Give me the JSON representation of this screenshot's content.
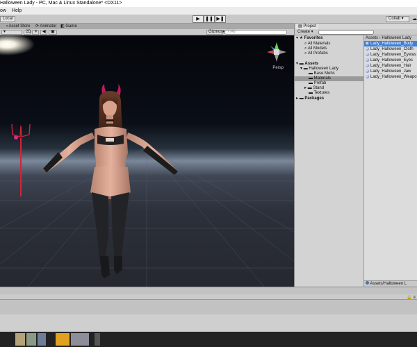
{
  "window": {
    "title": "Halloween Lady - PC, Mac & Linux Standalone* <DX11>"
  },
  "menu": {
    "items": [
      "ow",
      "Help"
    ]
  },
  "toolbar": {
    "local_label": "Local",
    "play_icon": "play-icon",
    "pause_icon": "pause-icon",
    "step_icon": "step-icon",
    "collab_label": "Collab"
  },
  "tabs": [
    {
      "label": "Asset Store"
    },
    {
      "label": "Animator"
    },
    {
      "label": "Game"
    }
  ],
  "scene_toolbar": {
    "mode_2d": "2D",
    "gizmos_label": "Gizmos",
    "search_placeholder": "ⓒAll",
    "persp_label": "Persp"
  },
  "project": {
    "tab_label": "Project",
    "create_label": "Create",
    "favorites": {
      "label": "Favorites",
      "items": [
        "All Materials",
        "All Models",
        "All Prefabs"
      ]
    },
    "assets": {
      "label": "Assets",
      "root_folder": "Halloween Lady",
      "subfolders": [
        "Base Mehs",
        "Materials",
        "Prefab",
        "Stand",
        "Textures"
      ]
    },
    "packages_label": "Packages",
    "breadcrumb": "Assets › Halloween Lady",
    "files": [
      "Lady_Halloween_Body",
      "Lady_Halloween_Cloth",
      "Lady_Halloween_Eyelas",
      "Lady_Halloween_Eyes",
      "Lady_Halloween_Hair",
      "Lady_Halloween_Jaw",
      "Lady_Halloween_Weapo"
    ],
    "footer_path": "Assets/Halloween L"
  },
  "colors": {
    "selection_blue": "#3f7fd6",
    "editor_gray": "#c2c2c2",
    "sky_dark": "#04060b",
    "horizon": "#7a889a"
  }
}
